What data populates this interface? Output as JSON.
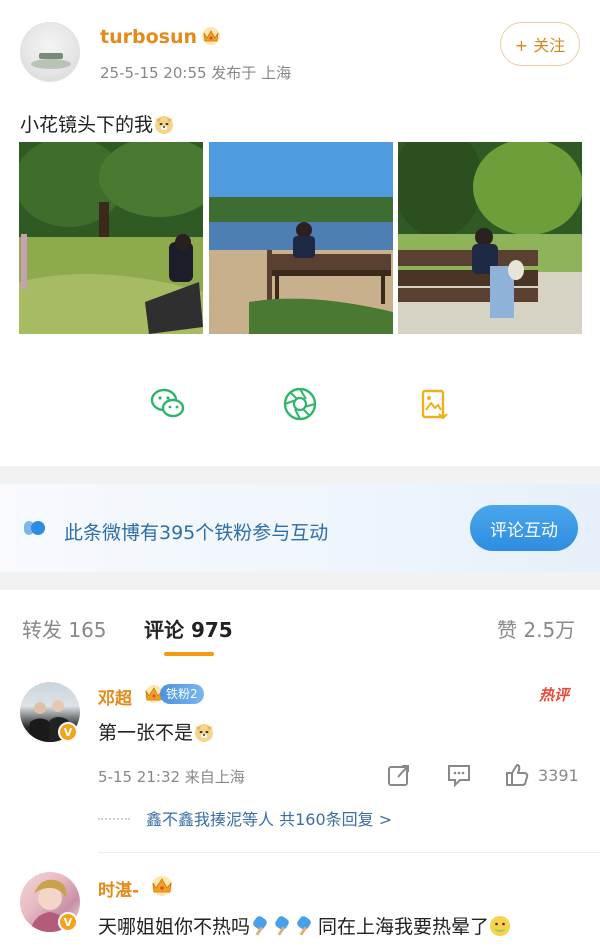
{
  "post": {
    "username": "turbosun",
    "meta": "25-5-15 20:55  发布于 上海",
    "follow_label": "+ 关注",
    "text": "小花镜头下的我",
    "images": [
      "park-photo-1",
      "lake-bench-photo",
      "bench-photo-3"
    ]
  },
  "share": {
    "icons": [
      "wechat-icon",
      "moments-icon",
      "save-image-icon"
    ]
  },
  "banner": {
    "text": "此条微博有395个铁粉参与互动",
    "button_label": "评论互动"
  },
  "tabs": {
    "repost": "转发 165",
    "comment": "评论 975",
    "like": "赞 2.5万"
  },
  "comments": [
    {
      "name": "邓超",
      "fan_badge": "铁粉2",
      "hot_tag": "热评",
      "text": "第一张不是",
      "meta": "5-15 21:32  来自上海",
      "likes": "3391",
      "replies": "鑫不鑫我揍泥等人  共160条回复 >"
    },
    {
      "name": "时湛-",
      "text": "天哪姐姐你不热吗",
      "text_after": "同在上海我要热晕了"
    }
  ],
  "colors": {
    "brand_orange": "#e38a1b",
    "link_blue": "#2e6ea8",
    "button_blue": "#2e8de0",
    "tab_underline": "#f39a13",
    "hot_red": "#e84b3c"
  }
}
